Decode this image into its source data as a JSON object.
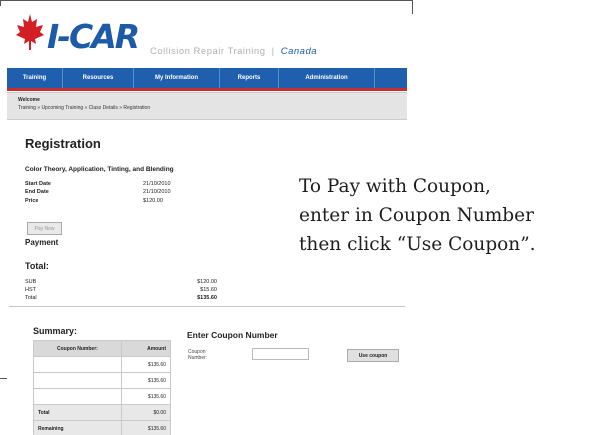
{
  "logo": {
    "text": "I-CAR",
    "small_text": ""
  },
  "tagline": {
    "part1": "Collision",
    "part2": "Repair",
    "part3": "Training",
    "sep": "|",
    "canada": "Canada"
  },
  "nav": [
    "Training",
    "Resources",
    "My Information",
    "Reports",
    "Administration"
  ],
  "breadcrumb": {
    "welcome": "Welcome",
    "trail": "Training » Upcoming Training » Class Details » Registration"
  },
  "registration": {
    "title": "Registration",
    "course": "Color Theory, Application, Tinting, and Blending",
    "start_label": "Start Date",
    "start_value": "21/10/2010",
    "end_label": "End Date",
    "end_value": "21/10/2010",
    "price_label": "Price",
    "price_value": "$120.00",
    "pay_now": "Pay Now"
  },
  "payment": {
    "title": "Payment",
    "total_title": "Total:",
    "rows": [
      {
        "label": "SUB",
        "value": "$120.00"
      },
      {
        "label": "HST",
        "value": "$15.60"
      },
      {
        "label": "Total",
        "value": "$135.60"
      }
    ]
  },
  "summary": {
    "title": "Summary:",
    "col_coupon": "Coupon Number:",
    "col_amount": "Amount",
    "rows": [
      {
        "coupon": "",
        "amount": "$135.60"
      },
      {
        "coupon": "",
        "amount": "$135.60"
      },
      {
        "coupon": "",
        "amount": "$135.60"
      }
    ],
    "total_label": "Total",
    "total_value": "$0.00",
    "remaining_label": "Remaining",
    "remaining_value": "$135.60"
  },
  "coupon": {
    "title": "Enter Coupon Number",
    "label_line1": "Coupon",
    "label_line2": "Number:",
    "value": "",
    "button": "Use coupon"
  },
  "callout": {
    "line1": "To Pay with Coupon,",
    "line2": "enter in Coupon Number",
    "line3": "then click “Use Coupon”."
  },
  "colors": {
    "nav_blue": "#1f5fae",
    "accent_red": "#c62d2d",
    "brand_blue": "#1d5aa8",
    "leaf_red": "#d21f26"
  }
}
